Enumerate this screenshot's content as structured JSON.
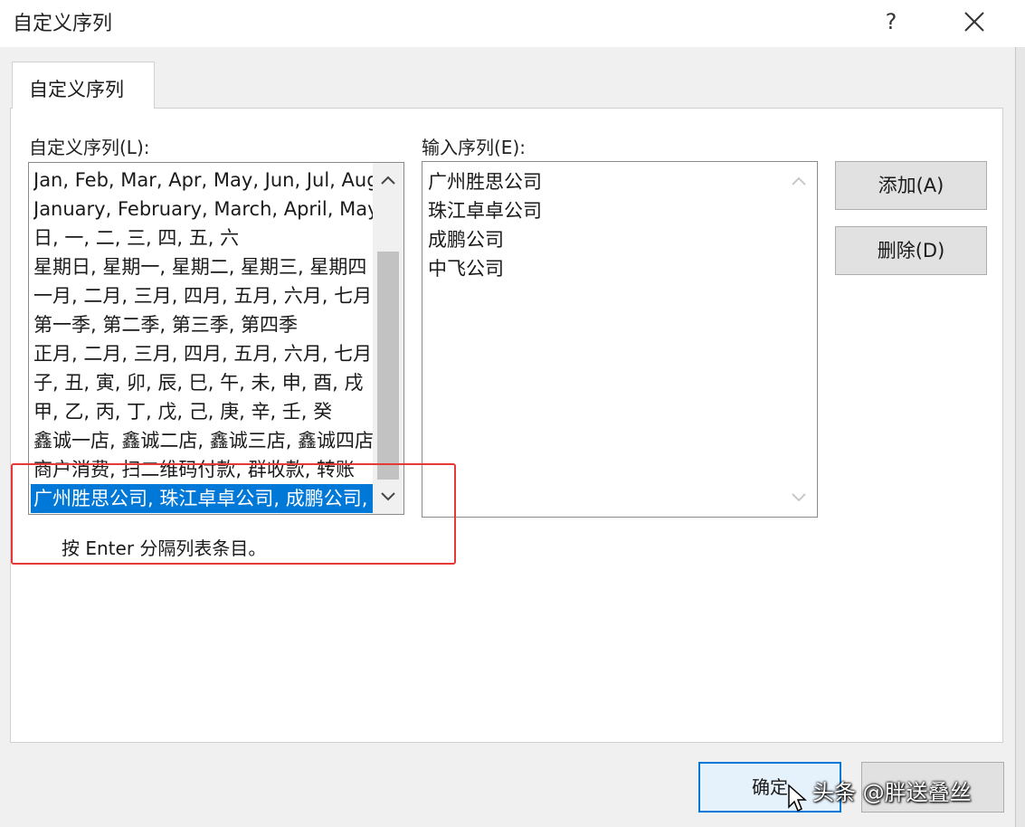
{
  "window": {
    "title": "自定义序列",
    "help_label": "?"
  },
  "tab": {
    "label": "自定义序列"
  },
  "custom_lists": {
    "label": "自定义序列(L):",
    "items": [
      "Jan, Feb, Mar, Apr, May, Jun, Jul, Aug",
      "January, February, March, April, May",
      "日, 一, 二, 三, 四, 五, 六",
      "星期日, 星期一, 星期二, 星期三, 星期四",
      "一月, 二月, 三月, 四月, 五月, 六月, 七月",
      "第一季, 第二季, 第三季, 第四季",
      "正月, 二月, 三月, 四月, 五月, 六月, 七月",
      "子, 丑, 寅, 卯, 辰, 巳, 午, 未, 申, 酉, 戌",
      "甲, 乙, 丙, 丁, 戊, 己, 庚, 辛, 壬, 癸",
      "鑫诚一店, 鑫诚二店, 鑫诚三店, 鑫诚四店",
      "商户消费, 扫二维码付款, 群收款, 转账",
      "广州胜思公司, 珠江卓卓公司, 成鹏公司, 中飞公司"
    ],
    "selected_index": 11
  },
  "entries": {
    "label": "输入序列(E):",
    "lines": [
      "广州胜思公司",
      "珠江卓卓公司",
      "成鹏公司",
      "中飞公司"
    ]
  },
  "buttons": {
    "add": "添加(A)",
    "delete": "删除(D)",
    "ok": "确定"
  },
  "hint": "按 Enter 分隔列表条目。",
  "watermark": "头条 @胖送叠丝",
  "colors": {
    "selection": "#0078d7",
    "highlight_box": "#e53935"
  }
}
